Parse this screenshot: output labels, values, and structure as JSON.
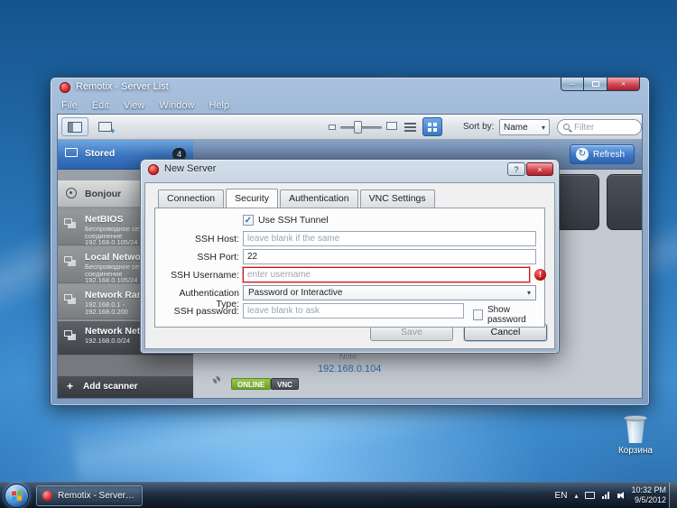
{
  "colors": {
    "accent_blue": "#2f6db0",
    "online_green": "#7ab648",
    "error_red": "#cc1414",
    "selected_row_blue": "#3a77c2"
  },
  "icons": {
    "check": "✓",
    "dropdown_arrow": "▾",
    "refresh": "↻",
    "error_mark": "!",
    "add": "+",
    "minimize": "–",
    "close": "×",
    "help": "?",
    "up_arrow": "▴",
    "monitor_plus": "+"
  },
  "desktop": {
    "recycle_bin": {
      "label": "Корзина"
    }
  },
  "taskbar": {
    "app_button": {
      "label": "Remotix - Server L..."
    },
    "tray": {
      "language": "EN",
      "time": "10:32 PM",
      "date": "9/5/2012"
    }
  },
  "main_window": {
    "title": "Remotix - Server List",
    "menu": {
      "items": [
        {
          "label": "File"
        },
        {
          "label": "Edit"
        },
        {
          "label": "View"
        },
        {
          "label": "Window"
        },
        {
          "label": "Help"
        }
      ]
    },
    "toolbar": {
      "sort_by_label": "Sort by:",
      "sort_value": "Name",
      "filter_placeholder": "Filter",
      "refresh_label": "Refresh"
    },
    "sidebar": {
      "items": [
        {
          "label": "Stored",
          "badge": "4"
        },
        {
          "label": "Bonjour"
        },
        {
          "label": "NetBIOS",
          "line1": "Беспроводное сет...",
          "line2": "соединение",
          "line3": "192.168.0.105/24"
        },
        {
          "label": "Local Network",
          "line1": "Беспроводное сет...",
          "line2": "соединение",
          "line3": "192.168.0.105/24"
        },
        {
          "label": "Network Range",
          "line1": "192.168.0.1 -",
          "line2": "192.168.0.200"
        },
        {
          "label": "Network Netmask",
          "line1": "192.168.0.0/24"
        }
      ],
      "add_scanner_label": "Add scanner"
    },
    "content": {
      "note_label": "Note:",
      "host": "192.168.0.104",
      "online_badge": "ONLINE",
      "vnc_badge": "VNC"
    }
  },
  "dialog": {
    "title": "New Server",
    "tabs": [
      {
        "label": "Connection"
      },
      {
        "label": "Security"
      },
      {
        "label": "Authentication"
      },
      {
        "label": "VNC Settings"
      }
    ],
    "active_tab": "Security",
    "form": {
      "use_ssh_tunnel": {
        "label": "Use SSH Tunnel",
        "checked": true
      },
      "ssh_host": {
        "label": "SSH Host:",
        "placeholder": "leave blank if the same",
        "value": ""
      },
      "ssh_port": {
        "label": "SSH Port:",
        "value": "22"
      },
      "ssh_username": {
        "label": "SSH Username:",
        "placeholder": "enter username",
        "value": "",
        "error": true
      },
      "auth_type": {
        "label": "Authentication Type:",
        "value": "Password or Interactive"
      },
      "ssh_password": {
        "label": "SSH password:",
        "placeholder": "leave blank to ask",
        "value": ""
      },
      "show_password": {
        "label": "Show password",
        "checked": false
      }
    },
    "buttons": {
      "save": "Save",
      "cancel": "Cancel"
    }
  }
}
